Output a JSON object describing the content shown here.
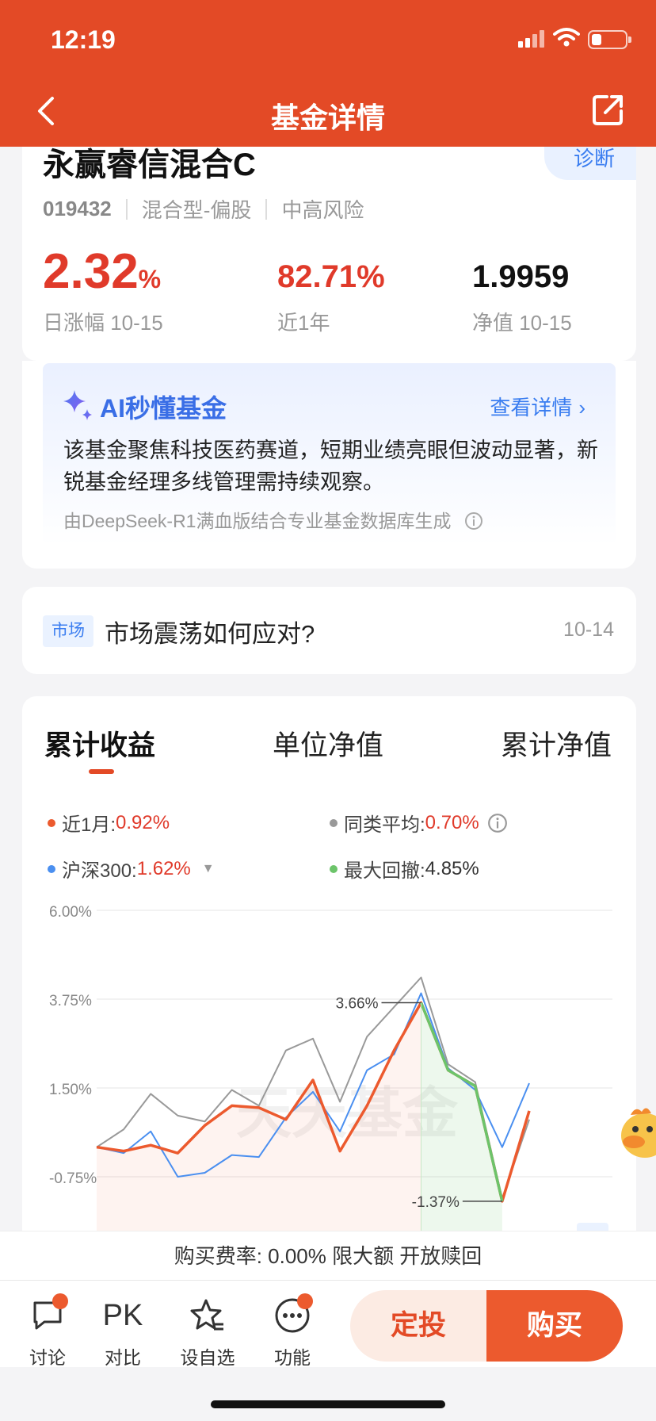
{
  "status_bar": {
    "time": "12:19"
  },
  "nav": {
    "title": "基金详情"
  },
  "fund": {
    "name": "永赢睿信混合C",
    "diagnose_label": "诊断",
    "code": "019432",
    "category": "混合型-偏股",
    "risk": "中高风险",
    "daily_change": "2.32",
    "daily_change_unit": "%",
    "daily_change_label": "日涨幅 10-15",
    "one_year": "82.71%",
    "one_year_label": "近1年",
    "nav_value": "1.9959",
    "nav_label": "净值 10-15"
  },
  "ai": {
    "title": "AI秒懂基金",
    "link": "查看详情",
    "text": "该基金聚焦科技医药赛道，短期业绩亮眼但波动显著，新锐基金经理多线管理需持续观察。",
    "source": "由DeepSeek-R1满血版结合专业基金数据库生成"
  },
  "news": {
    "tag": "市场",
    "title": "市场震荡如何应对?",
    "date": "10-14"
  },
  "tabs": [
    "累计收益",
    "单位净值",
    "累计净值"
  ],
  "legend": {
    "fund": {
      "label": "近1月:",
      "value": "0.92%",
      "color": "#ec5a2e"
    },
    "peer": {
      "label": "同类平均:",
      "value": "0.70%",
      "color": "#999999"
    },
    "index": {
      "label": "沪深300:",
      "value": "1.62%",
      "color": "#4a8ff0"
    },
    "drawdown": {
      "label": "最大回撤:",
      "value": "4.85%",
      "color": "#6cc46a"
    }
  },
  "chart_data": {
    "type": "line",
    "y_tick_labels": [
      "6.00%",
      "3.75%",
      "1.50%",
      "-0.75%"
    ],
    "ylim": [
      -3.0,
      6.0
    ],
    "watermark": "天天基金",
    "annotations": [
      {
        "text": "3.66%",
        "point_index": 12
      },
      {
        "text": "-1.37%",
        "point_index": 15
      }
    ],
    "series": [
      {
        "name": "近1月",
        "color": "#ec5a2e",
        "values": [
          0.0,
          -0.1,
          0.05,
          -0.15,
          0.55,
          1.05,
          1.0,
          0.7,
          1.7,
          -0.1,
          1.05,
          2.45,
          3.66,
          1.95,
          1.55,
          -1.37,
          0.92
        ]
      },
      {
        "name": "同类平均",
        "color": "#999999",
        "values": [
          0.0,
          0.45,
          1.35,
          0.8,
          0.65,
          1.45,
          1.05,
          2.45,
          2.75,
          1.15,
          2.8,
          3.55,
          4.3,
          2.1,
          1.65,
          -1.3,
          0.7
        ]
      },
      {
        "name": "沪深300",
        "color": "#4a8ff0",
        "values": [
          0.0,
          -0.15,
          0.4,
          -0.75,
          -0.65,
          -0.2,
          -0.25,
          0.75,
          1.4,
          0.4,
          1.95,
          2.35,
          3.9,
          2.0,
          1.45,
          0.0,
          1.62
        ]
      }
    ],
    "drawdown_range": [
      12,
      15
    ]
  },
  "fee": {
    "text": "购买费率: 0.00%  限大额  开放赎回"
  },
  "bottom": {
    "discuss": "讨论",
    "compare_icon": "PK",
    "compare": "对比",
    "watch": "设自选",
    "function": "功能",
    "invest": "定投",
    "buy": "购买"
  },
  "colors": {
    "brand": "#e34a26",
    "up": "#e03a2a",
    "link": "#3a7df0"
  }
}
